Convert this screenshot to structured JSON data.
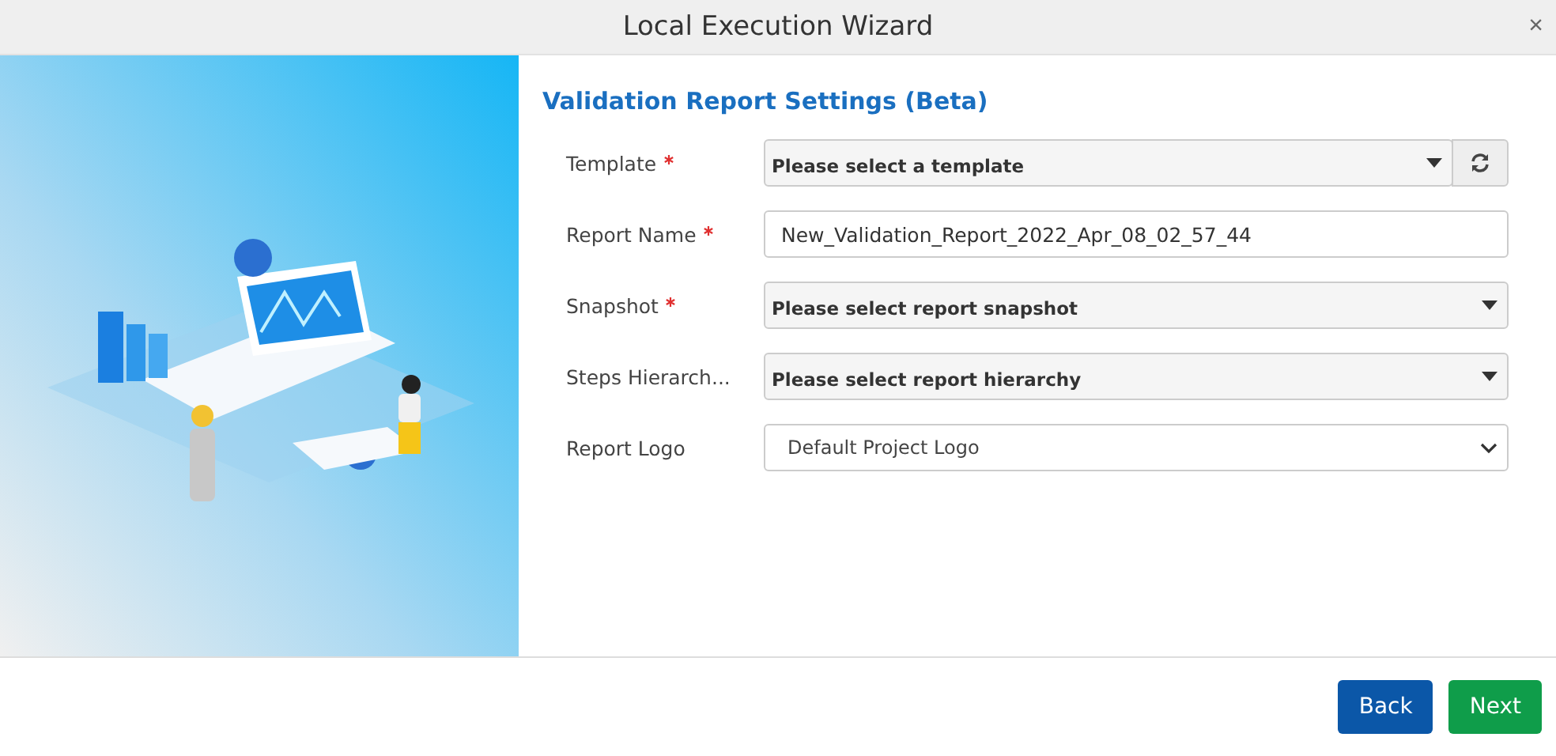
{
  "window": {
    "title": "Local Execution Wizard",
    "close": "×"
  },
  "section_title": "Validation Report Settings (Beta)",
  "fields": [
    {
      "label": "Template",
      "required": true,
      "kind": "select",
      "value": "Please select a template",
      "refresh": true
    },
    {
      "label": "Report Name",
      "required": true,
      "kind": "text",
      "value": "New_Validation_Report_2022_Apr_08_02_57_44",
      "refresh": false
    },
    {
      "label": "Snapshot",
      "required": true,
      "kind": "select",
      "value": "Please select report snapshot",
      "refresh": false
    },
    {
      "label": "Steps Hierarch...",
      "required": false,
      "kind": "select",
      "value": "Please select report hierarchy",
      "refresh": false
    },
    {
      "label": "Report Logo",
      "required": false,
      "kind": "native",
      "value": "Default Project Logo",
      "refresh": false
    }
  ],
  "buttons": [
    {
      "label": "Back",
      "kind": "secondary"
    },
    {
      "label": "Next",
      "kind": "primary"
    }
  ]
}
